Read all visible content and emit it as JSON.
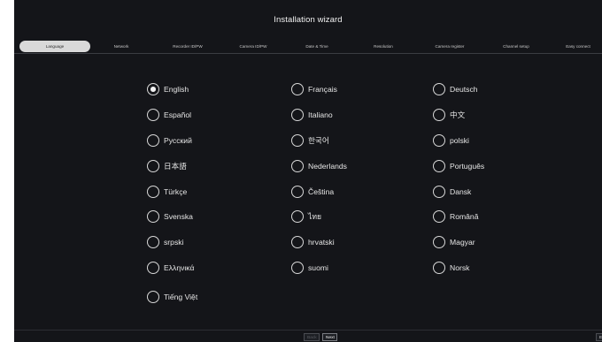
{
  "wizard": {
    "title": "Installation wizard"
  },
  "steps": [
    {
      "label": "Language",
      "active": true
    },
    {
      "label": "Network",
      "active": false
    },
    {
      "label": "Recorder ID/PW",
      "active": false
    },
    {
      "label": "Camera ID/PW",
      "active": false
    },
    {
      "label": "Date & Time",
      "active": false
    },
    {
      "label": "Resolution",
      "active": false
    },
    {
      "label": "Camera register",
      "active": false
    },
    {
      "label": "Channel setup",
      "active": false
    },
    {
      "label": "Easy connect",
      "active": false
    }
  ],
  "languages": {
    "selected": "English",
    "col1": [
      "English",
      "Español",
      "Русский",
      "日本語",
      "Türkçe",
      "Svenska",
      "srpski",
      "Ελληνικά",
      "Tiếng Việt"
    ],
    "col2": [
      "Français",
      "Italiano",
      "한국어",
      "Nederlands",
      "Čeština",
      "ไทย",
      "hrvatski",
      "suomi"
    ],
    "col3": [
      "Deutsch",
      "中文",
      "polski",
      "Português",
      "Dansk",
      "Română",
      "Magyar",
      "Norsk"
    ]
  },
  "footer": {
    "back_label": "Back",
    "next_label": "Next",
    "exit_label": "Ex"
  },
  "colors": {
    "background": "#141519",
    "text": "#e6e6e6",
    "active_tab": "#d9d9d9"
  }
}
